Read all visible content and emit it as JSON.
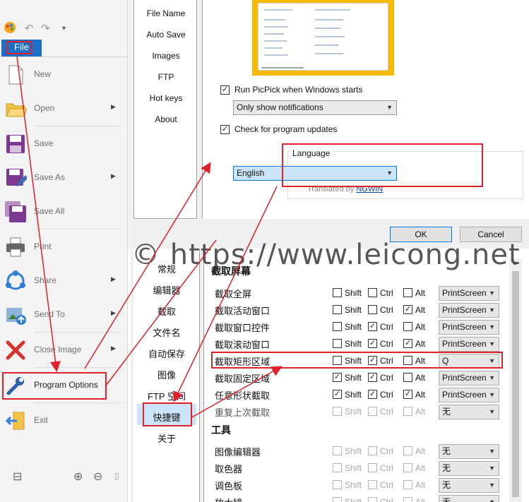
{
  "file_menu": {
    "tab_label": "File",
    "items": [
      {
        "label": "New",
        "icon": "new-document-icon",
        "submenu": false
      },
      {
        "label": "Open",
        "icon": "open-folder-icon",
        "submenu": true
      },
      {
        "label": "Save",
        "icon": "save-icon",
        "submenu": false
      },
      {
        "label": "Save As",
        "icon": "save-as-icon",
        "submenu": true
      },
      {
        "label": "Save All",
        "icon": "save-all-icon",
        "submenu": false
      },
      {
        "label": "Print",
        "icon": "printer-icon",
        "submenu": false
      },
      {
        "label": "Share",
        "icon": "share-icon",
        "submenu": true
      },
      {
        "label": "Send To",
        "icon": "send-to-icon",
        "submenu": true
      },
      {
        "label": "Close Image",
        "icon": "close-x-icon",
        "submenu": true
      },
      {
        "label": "Program Options",
        "icon": "wrench-icon",
        "submenu": false
      },
      {
        "label": "Exit",
        "icon": "exit-icon",
        "submenu": false
      }
    ]
  },
  "top_options": {
    "nav": [
      "File Name",
      "Auto Save",
      "Images",
      "FTP",
      "Hot keys",
      "About"
    ],
    "run_on_start_label": "Run PicPick when Windows starts",
    "notify_select": "Only show notifications",
    "check_updates_label": "Check for program updates",
    "language_group_title": "Language",
    "language_value": "English",
    "translated_by": "Translated by",
    "translator": "NGWIN",
    "ok_label": "OK",
    "cancel_label": "Cancel"
  },
  "watermark": "© https://www.leicong.net",
  "cn_options": {
    "nav": [
      "常规",
      "编辑器",
      "截取",
      "文件名",
      "自动保存",
      "图像",
      "FTP 空间",
      "快捷键",
      "关于"
    ],
    "section_capture": "截取屏幕",
    "section_tools": "工具",
    "capture_rows": [
      {
        "label": "截取全屏",
        "shift": false,
        "ctrl": false,
        "alt": false,
        "key": "PrintScreen",
        "disabled": false
      },
      {
        "label": "截取活动窗口",
        "shift": false,
        "ctrl": false,
        "alt": true,
        "key": "PrintScreen",
        "disabled": false
      },
      {
        "label": "截取窗口控件",
        "shift": false,
        "ctrl": true,
        "alt": false,
        "key": "PrintScreen",
        "disabled": false
      },
      {
        "label": "截取滚动窗口",
        "shift": false,
        "ctrl": true,
        "alt": true,
        "key": "PrintScreen",
        "disabled": false
      },
      {
        "label": "截取矩形区域",
        "shift": false,
        "ctrl": true,
        "alt": false,
        "key": "Q",
        "disabled": false
      },
      {
        "label": "截取固定区域",
        "shift": true,
        "ctrl": true,
        "alt": false,
        "key": "PrintScreen",
        "disabled": false
      },
      {
        "label": "任意形状截取",
        "shift": true,
        "ctrl": true,
        "alt": true,
        "key": "PrintScreen",
        "disabled": false
      },
      {
        "label": "重复上次截取",
        "shift": false,
        "ctrl": false,
        "alt": false,
        "key": "无",
        "disabled": true
      }
    ],
    "tool_rows": [
      {
        "label": "图像编辑器",
        "key": "无"
      },
      {
        "label": "取色器",
        "key": "无"
      },
      {
        "label": "调色板",
        "key": "无"
      },
      {
        "label": "放大镜",
        "key": "无"
      }
    ],
    "mod_shift": "Shift",
    "mod_ctrl": "Ctrl",
    "mod_alt": "Alt"
  },
  "colors": {
    "accent": "#1e6fc8",
    "highlight": "#e0202a",
    "selection": "#cce4f7"
  }
}
